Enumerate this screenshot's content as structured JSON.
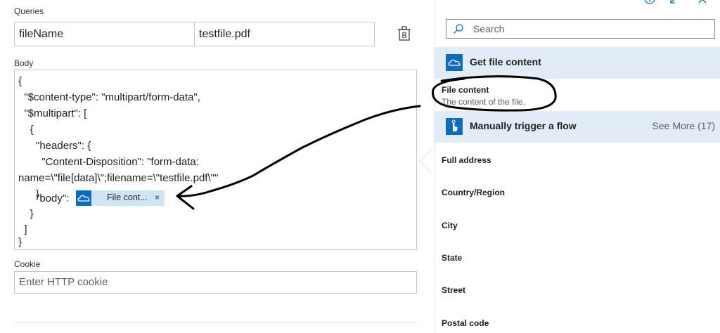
{
  "queries": {
    "label": "Queries",
    "key": "fileName",
    "value": "testfile.pdf"
  },
  "body": {
    "label": "Body",
    "lines": [
      "{",
      "  \"$content-type\": \"multipart/form-data\",",
      "  \"$multipart\": [",
      "    {",
      "      \"headers\": {",
      "        \"Content-Disposition\": \"form-data:",
      "name=\\\"file[data]\\\";filename=\\\"testfile.pdf\\\"\"",
      "      },",
      "      \"body\": ",
      "    }",
      "  ]",
      "}"
    ],
    "token_label": "File cont...",
    "token_close": "×"
  },
  "cookie": {
    "label": "Cookie",
    "placeholder": "Enter HTTP cookie"
  },
  "panel": {
    "search_placeholder": "Search",
    "sections": [
      {
        "title": "Get file content",
        "items": [
          {
            "title": "File content",
            "description": "The content of the file."
          }
        ]
      },
      {
        "title": "Manually trigger a flow",
        "see_more": "See More (17)",
        "items": [
          {
            "title": "Full address"
          },
          {
            "title": "Country/Region"
          },
          {
            "title": "City"
          },
          {
            "title": "State"
          },
          {
            "title": "Street"
          },
          {
            "title": "Postal code"
          }
        ]
      }
    ]
  },
  "icons": {
    "delete": "delete-icon",
    "search": "search-icon",
    "onedrive": "onedrive-icon",
    "trigger": "manual-trigger-icon",
    "info": "info-icon",
    "expand": "expand-icon",
    "close": "close-icon"
  },
  "colors": {
    "accent": "#0f6cbd",
    "section_bg": "#e1ecf7",
    "token_bg": "#cfe4f4",
    "annotation": "#000000"
  }
}
